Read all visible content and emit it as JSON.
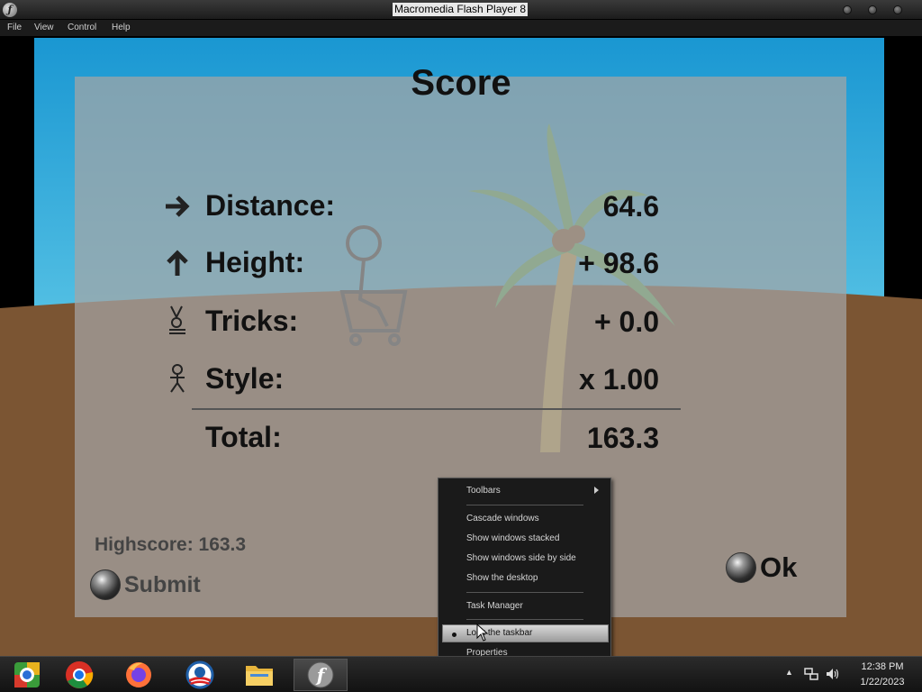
{
  "window": {
    "title": "Macromedia Flash Player 8"
  },
  "menubar": {
    "items": [
      "File",
      "View",
      "Control",
      "Help"
    ]
  },
  "score_panel": {
    "title": "Score",
    "rows": [
      {
        "label": "Distance:",
        "value": "64.6",
        "icon": "arrow-right-icon"
      },
      {
        "label": "Height:",
        "value": "+ 98.6",
        "icon": "arrow-up-icon"
      },
      {
        "label": "Tricks:",
        "value": "+ 0.0",
        "icon": "trick-figure-icon"
      },
      {
        "label": "Style:",
        "value": "x 1.00",
        "icon": "stick-figure-icon"
      }
    ],
    "total": {
      "label": "Total:",
      "value": "163.3"
    },
    "highscore": "Highscore: 163.3",
    "submit_label": "Submit",
    "ok_label": "Ok"
  },
  "context_menu": {
    "items": [
      "Toolbars",
      "Cascade windows",
      "Show windows stacked",
      "Show windows side by side",
      "Show the desktop",
      "Task Manager",
      "Lock the taskbar",
      "Properties"
    ],
    "checked": "Lock the taskbar",
    "highlighted": "Lock the taskbar"
  },
  "taskbar": {
    "apps": [
      "chrome-remote-desktop-icon",
      "chrome-icon",
      "firefox-icon",
      "obama-logo-icon",
      "file-explorer-icon",
      "flash-player-icon"
    ],
    "active_app": "flash-player-icon",
    "clock": {
      "time": "12:38 PM",
      "date": "1/22/2023"
    }
  },
  "colors": {
    "sky": "#1a97d2",
    "ground": "#7b5533",
    "panel": "#a5a5a5"
  }
}
